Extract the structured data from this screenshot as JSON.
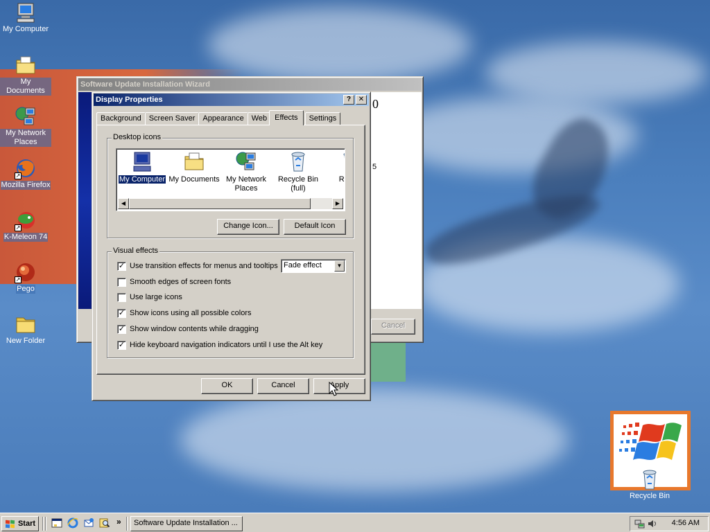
{
  "desktop": {
    "icons": [
      {
        "label": "My Computer",
        "icon": "computer-icon"
      },
      {
        "label": "My Documents",
        "icon": "documents-folder-icon"
      },
      {
        "label": "My Network Places",
        "icon": "network-places-icon"
      },
      {
        "label": "Mozilla Firefox",
        "icon": "firefox-icon"
      },
      {
        "label": "K-Meleon 74",
        "icon": "k-meleon-icon"
      },
      {
        "label": "Pego",
        "icon": "pego-icon"
      },
      {
        "label": "New Folder",
        "icon": "folder-icon"
      },
      {
        "label": "Recycle Bin",
        "icon": "recycle-bin-icon"
      }
    ]
  },
  "wizard": {
    "title": "Software Update Installation Wizard",
    "cancel_label": "Cancel",
    "partial_text_1": "0",
    "partial_text_2": "5"
  },
  "dialog": {
    "title": "Display Properties",
    "help_label": "?",
    "close_label": "✕",
    "tabs": [
      "Background",
      "Screen Saver",
      "Appearance",
      "Web",
      "Effects",
      "Settings"
    ],
    "active_tab": "Effects",
    "desktop_icons": {
      "legend": "Desktop icons",
      "items": [
        {
          "label": "My Computer",
          "selected": true,
          "icon": "computer-icon"
        },
        {
          "label": "My Documents",
          "selected": false,
          "icon": "documents-folder-icon"
        },
        {
          "label": "My Network Places",
          "selected": false,
          "icon": "network-places-icon"
        },
        {
          "label": "Recycle Bin (full)",
          "selected": false,
          "icon": "recycle-bin-full-icon"
        },
        {
          "label": "Rec (e",
          "selected": false,
          "icon": "recycle-bin-empty-icon"
        }
      ],
      "change_icon_label": "Change Icon...",
      "default_icon_label": "Default Icon"
    },
    "visual_effects": {
      "legend": "Visual effects",
      "options": [
        {
          "label": "Use transition effects for menus and tooltips",
          "checked": true
        },
        {
          "label": "Smooth edges of screen fonts",
          "checked": false
        },
        {
          "label": "Use large icons",
          "checked": false
        },
        {
          "label": "Show icons using all possible colors",
          "checked": true
        },
        {
          "label": "Show window contents while dragging",
          "checked": true
        },
        {
          "label": "Hide keyboard navigation indicators until I use the Alt key",
          "checked": true
        }
      ],
      "transition_effect_value": "Fade effect"
    },
    "ok_label": "OK",
    "cancel_label": "Cancel",
    "apply_label": "Apply"
  },
  "taskbar": {
    "start_label": "Start",
    "quick_launch": [
      "show-desktop-icon",
      "internet-explorer-icon",
      "outlook-express-icon",
      "search-icon"
    ],
    "chevron": "»",
    "task_button_label": "Software Update Installation ...",
    "clock": "4:56 AM",
    "tray_icons": [
      "network-tray-icon",
      "volume-tray-icon"
    ]
  },
  "colors": {
    "title_active": "#0a246a",
    "face": "#d4d0c8",
    "desktop": "#3f6fae"
  }
}
